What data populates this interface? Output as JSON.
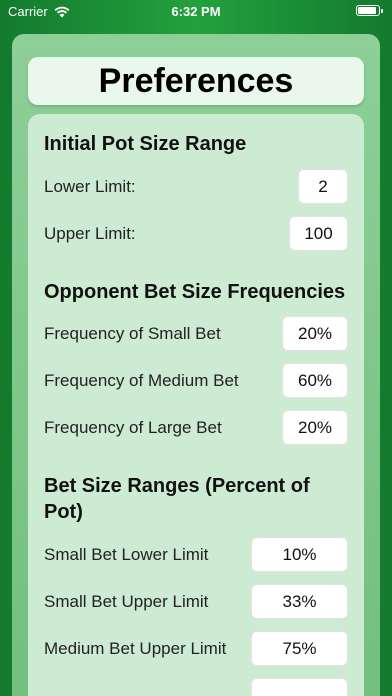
{
  "status": {
    "carrier": "Carrier",
    "time": "6:32 PM"
  },
  "title": "Preferences",
  "sections": {
    "pot": {
      "title": "Initial Pot Size Range",
      "lower_label": "Lower Limit:",
      "lower_value": "2",
      "upper_label": "Upper Limit:",
      "upper_value": "100"
    },
    "freq": {
      "title": "Opponent Bet Size Frequencies",
      "small_label": "Frequency of Small Bet",
      "small_value": "20%",
      "medium_label": "Frequency of Medium Bet",
      "medium_value": "60%",
      "large_label": "Frequency of Large Bet",
      "large_value": "20%"
    },
    "ranges": {
      "title": "Bet Size Ranges (Percent of Pot)",
      "small_lower_label": "Small Bet Lower Limit",
      "small_lower_value": "10%",
      "small_upper_label": "Small Bet Upper Limit",
      "small_upper_value": "33%",
      "medium_upper_label": "Medium Bet Upper Limit",
      "medium_upper_value": "75%"
    }
  }
}
